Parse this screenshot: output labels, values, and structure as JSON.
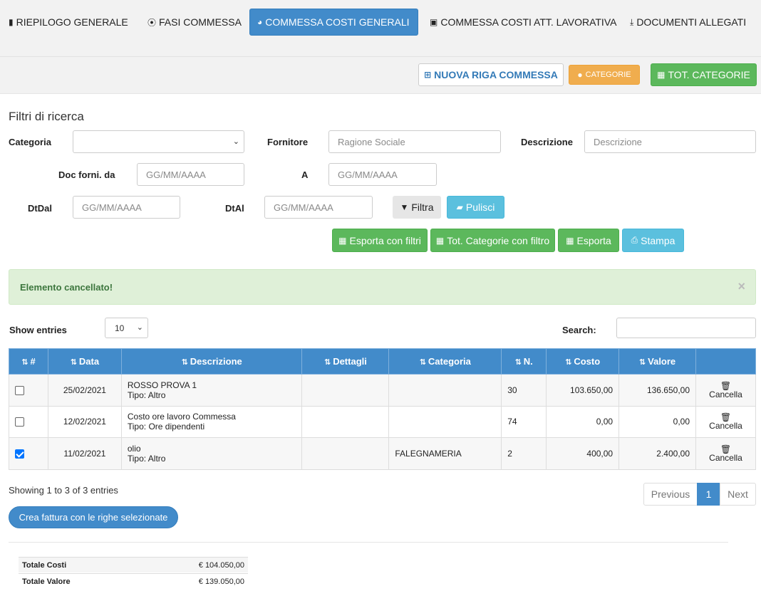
{
  "tabs": [
    {
      "label": "RIEPILOGO GENERALE",
      "icon": "bar-chart-icon"
    },
    {
      "label": "FASI COMMESSA",
      "icon": "life-ring-icon"
    },
    {
      "label": "COMMESSA COSTI GENERALI",
      "icon": "pie-chart-icon",
      "active": true
    },
    {
      "label": "COMMESSA COSTI ATT. LAVORATIVA",
      "icon": "briefcase-icon"
    },
    {
      "label": "DOCUMENTI ALLEGATI",
      "icon": "download-icon"
    }
  ],
  "actions": {
    "new_row": "NUOVA RIGA COMMESSA",
    "categories": "CATEGORIE",
    "tot_categories": "TOT. CATEGORIE"
  },
  "filters": {
    "title": "Filtri di ricerca",
    "categoria_label": "Categoria",
    "categoria_value": "",
    "fornitore_label": "Fornitore",
    "fornitore_placeholder": "Ragione Sociale",
    "descrizione_label": "Descrizione",
    "descrizione_placeholder": "Descrizione",
    "doc_from_label": "Doc forni. da",
    "doc_from_placeholder": "GG/MM/AAAA",
    "doc_to_label": "A",
    "doc_to_placeholder": "GG/MM/AAAA",
    "dtdal_label": "DtDal",
    "dtdal_placeholder": "GG/MM/AAAA",
    "dtal_label": "DtAl",
    "dtal_placeholder": "GG/MM/AAAA",
    "filter_button": "Filtra",
    "clear_button": "Pulisci",
    "export_filters": "Esporta con filtri",
    "tot_cat_filter": "Tot. Categorie con filtro",
    "export": "Esporta",
    "print": "Stampa"
  },
  "alert": {
    "message": "Elemento cancellato!",
    "close": "×"
  },
  "table_controls": {
    "show_entries_label": "Show entries",
    "entries_value": "10",
    "search_label": "Search:"
  },
  "table": {
    "headers": [
      "#",
      "Data",
      "Descrizione",
      "Dettagli",
      "Categoria",
      "N.",
      "Costo",
      "Valore"
    ],
    "rows": [
      {
        "checked": false,
        "data": "25/02/2021",
        "desc1": "ROSSO PROVA 1",
        "desc2": "Tipo: Altro",
        "dettagli": "",
        "categoria": "",
        "n": "30",
        "costo": "103.650,00",
        "valore": "136.650,00",
        "action": "Cancella"
      },
      {
        "checked": false,
        "data": "12/02/2021",
        "desc1": "Costo ore lavoro Commessa",
        "desc2": "Tipo: Ore dipendenti",
        "dettagli": "",
        "categoria": "",
        "n": "74",
        "costo": "0,00",
        "valore": "0,00",
        "action": "Cancella"
      },
      {
        "checked": true,
        "data": "11/02/2021",
        "desc1": "olio",
        "desc2": "Tipo: Altro",
        "dettagli": "",
        "categoria": "FALEGNAMERIA",
        "n": "2",
        "costo": "400,00",
        "valore": "2.400,00",
        "action": "Cancella"
      }
    ]
  },
  "pagination": {
    "info": "Showing 1 to 3 of 3 entries",
    "previous": "Previous",
    "current": "1",
    "next": "Next"
  },
  "invoice_button": "Crea fattura con le righe selezionate",
  "totals": [
    {
      "label": "Totale Costi",
      "value": "€ 104.050,00"
    },
    {
      "label": "Totale Valore",
      "value": "€ 139.050,00"
    }
  ],
  "colors": {
    "primary": "#428bca",
    "success": "#5cb85c",
    "warning": "#f0ad4e",
    "info": "#5bc0de"
  }
}
